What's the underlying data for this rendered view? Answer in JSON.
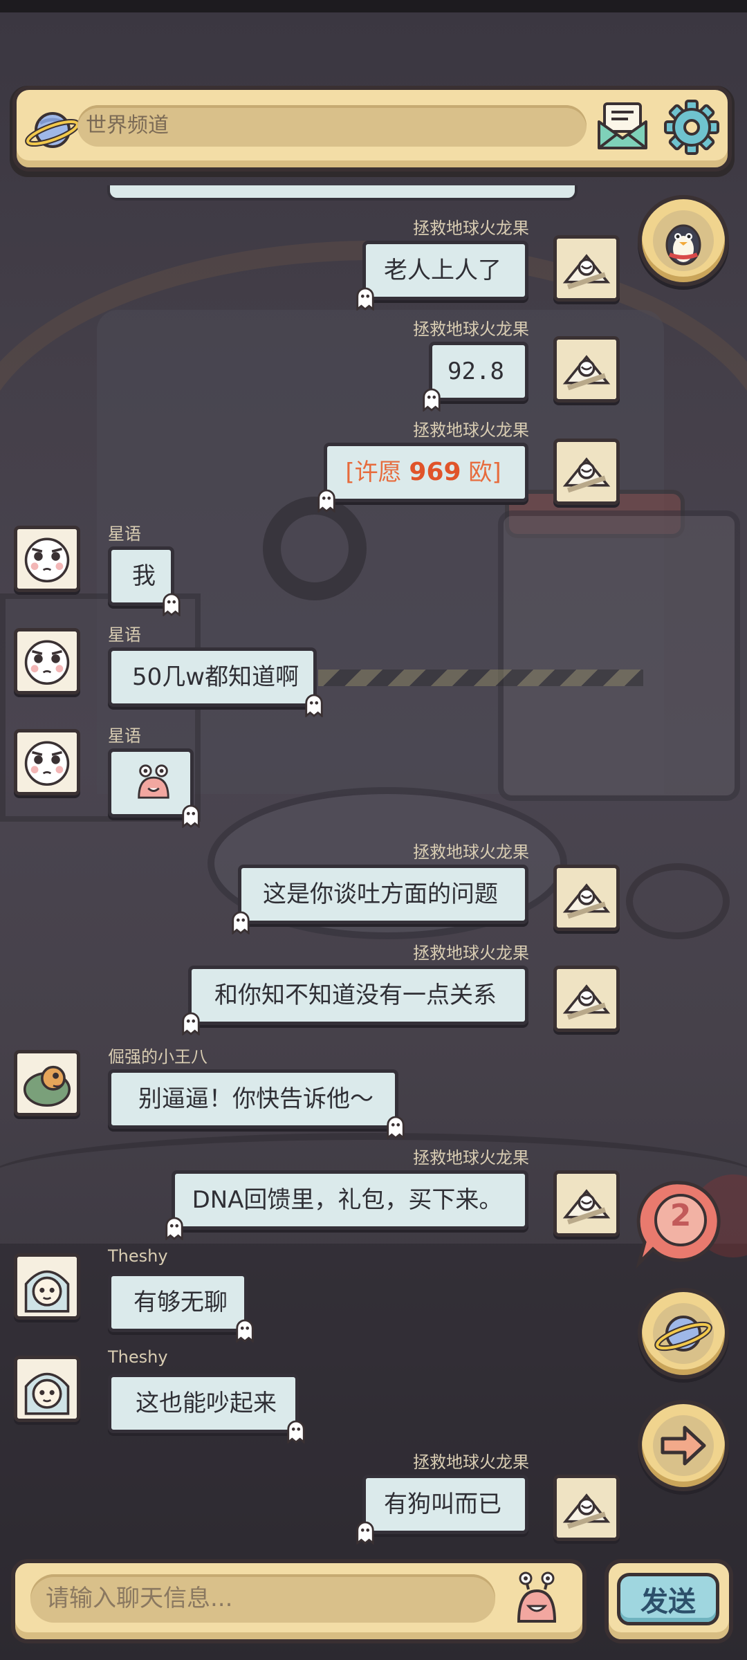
{
  "channel": {
    "label": "世界频道",
    "icons": {
      "channel": "planet-icon",
      "mail": "mail-icon",
      "settings": "gear-icon"
    }
  },
  "messages": [
    {
      "side": "right",
      "sender": "拯救地球火龙果",
      "text": "老人上人了"
    },
    {
      "side": "right",
      "sender": "拯救地球火龙果",
      "text": "92.8"
    },
    {
      "side": "right",
      "sender": "拯救地球火龙果",
      "text_prefix": "[许愿 ",
      "text_number": "969",
      "text_suffix": " 欧]"
    },
    {
      "side": "left",
      "sender": "星语",
      "text": "我"
    },
    {
      "side": "left",
      "sender": "星语",
      "text": "50几w都知道啊"
    },
    {
      "side": "left",
      "sender": "星语",
      "sticker": "snail-emoji-icon"
    },
    {
      "side": "right",
      "sender": "拯救地球火龙果",
      "text": "这是你谈吐方面的问题"
    },
    {
      "side": "right",
      "sender": "拯救地球火龙果",
      "text": "和你知不知道没有一点关系"
    },
    {
      "side": "left",
      "sender": "倔强的小王八",
      "text": "别逼逼！你快告诉他～"
    },
    {
      "side": "right",
      "sender": "拯救地球火龙果",
      "text": "DNA回馈里，礼包，买下来。"
    },
    {
      "side": "left",
      "sender": "Theshy",
      "text": "有够无聊"
    },
    {
      "side": "left",
      "sender": "Theshy",
      "text": "这也能吵起来"
    },
    {
      "side": "right",
      "sender": "拯救地球火龙果",
      "text": "有狗叫而已"
    }
  ],
  "side_buttons": {
    "penguin": "penguin-icon",
    "unread_badge": "2",
    "world": "planet-icon",
    "next": "arrow-right-icon"
  },
  "input": {
    "placeholder": "请输入聊天信息...",
    "send_label": "发送",
    "emoji": "snail-emoji-icon"
  },
  "colors": {
    "panel": "#f3dda6",
    "bubble": "#dbeaeb",
    "outline": "#343038",
    "wish": "#e76b3c",
    "send": "#9fd6df"
  }
}
